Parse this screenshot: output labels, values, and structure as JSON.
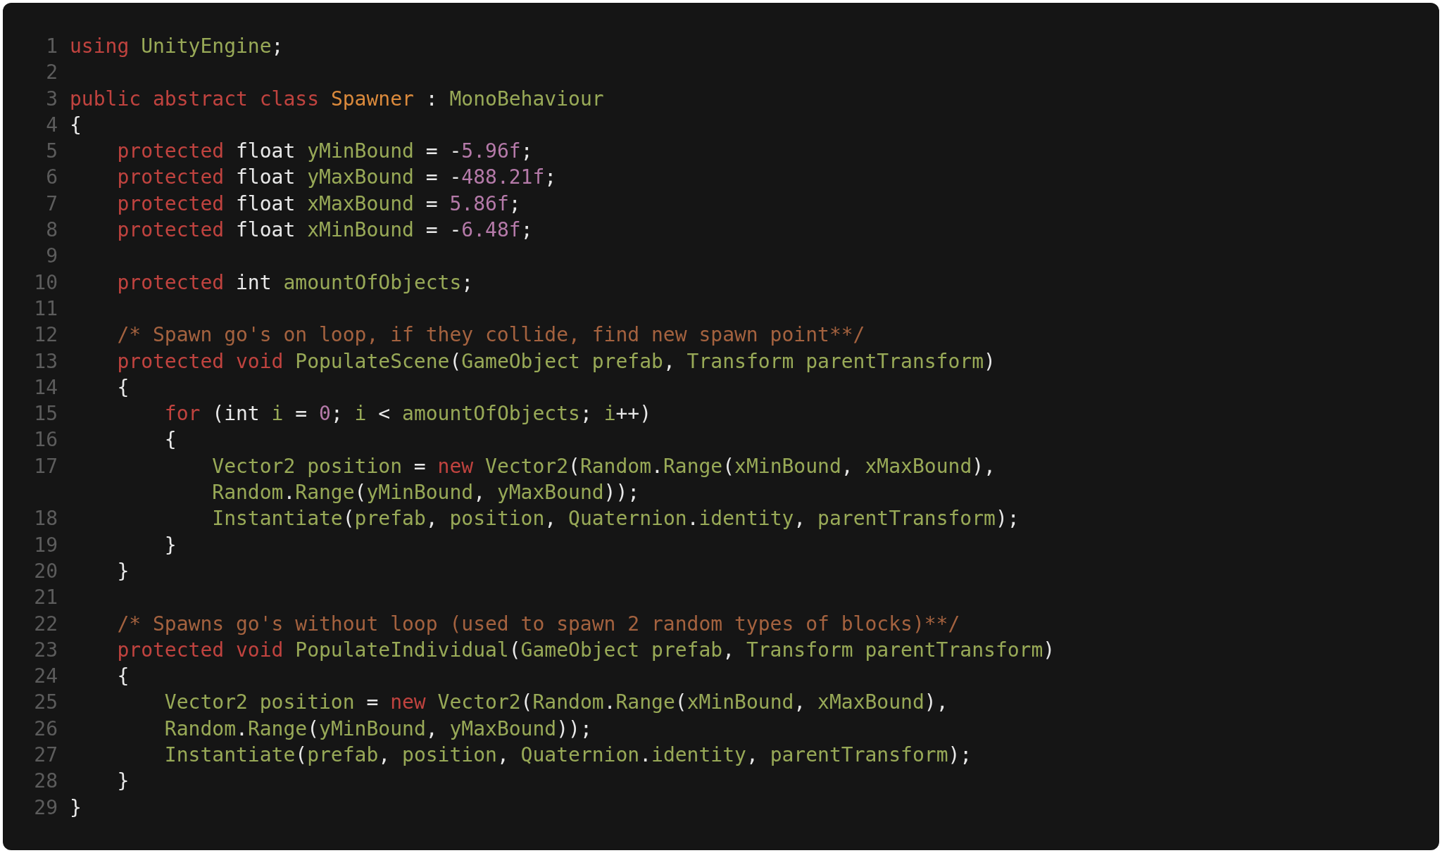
{
  "code_lines": [
    {
      "number": "1",
      "tokens": [
        {
          "text": "using ",
          "kind": "keyword"
        },
        {
          "text": "UnityEngine",
          "kind": "identifier"
        },
        {
          "text": ";",
          "kind": "plain"
        }
      ]
    },
    {
      "number": "2"
    },
    {
      "number": "3",
      "tokens": [
        {
          "text": "public abstract class ",
          "kind": "keyword"
        },
        {
          "text": "Spawner",
          "kind": "class"
        },
        {
          "text": " : ",
          "kind": "plain"
        },
        {
          "text": "MonoBehaviour",
          "kind": "identifier"
        }
      ]
    },
    {
      "number": "4",
      "tokens": [
        {
          "text": "{",
          "kind": "plain"
        }
      ]
    },
    {
      "number": "5",
      "tokens": [
        {
          "text": "    protected",
          "kind": "keyword"
        },
        {
          "text": " float ",
          "kind": "plain"
        },
        {
          "text": "yMinBound",
          "kind": "identifier"
        },
        {
          "text": " = -",
          "kind": "plain"
        },
        {
          "text": "5.96f",
          "kind": "number"
        },
        {
          "text": ";",
          "kind": "plain"
        }
      ]
    },
    {
      "number": "6",
      "tokens": [
        {
          "text": "    protected",
          "kind": "keyword"
        },
        {
          "text": " float ",
          "kind": "plain"
        },
        {
          "text": "yMaxBound",
          "kind": "identifier"
        },
        {
          "text": " = -",
          "kind": "plain"
        },
        {
          "text": "488.21f",
          "kind": "number"
        },
        {
          "text": ";",
          "kind": "plain"
        }
      ]
    },
    {
      "number": "7",
      "tokens": [
        {
          "text": "    protected",
          "kind": "keyword"
        },
        {
          "text": " float ",
          "kind": "plain"
        },
        {
          "text": "xMaxBound",
          "kind": "identifier"
        },
        {
          "text": " = ",
          "kind": "plain"
        },
        {
          "text": "5.86f",
          "kind": "number"
        },
        {
          "text": ";",
          "kind": "plain"
        }
      ]
    },
    {
      "number": "8",
      "tokens": [
        {
          "text": "    protected",
          "kind": "keyword"
        },
        {
          "text": " float ",
          "kind": "plain"
        },
        {
          "text": "xMinBound",
          "kind": "identifier"
        },
        {
          "text": " = -",
          "kind": "plain"
        },
        {
          "text": "6.48f",
          "kind": "number"
        },
        {
          "text": ";",
          "kind": "plain"
        }
      ]
    },
    {
      "number": "9"
    },
    {
      "number": "10",
      "tokens": [
        {
          "text": "    protected",
          "kind": "keyword"
        },
        {
          "text": " int ",
          "kind": "plain"
        },
        {
          "text": "amountOfObjects",
          "kind": "identifier"
        },
        {
          "text": ";",
          "kind": "plain"
        }
      ]
    },
    {
      "number": "11"
    },
    {
      "number": "12",
      "tokens": [
        {
          "text": "    /* Spawn go's on loop, if they collide, find new spawn point**/",
          "kind": "comment"
        }
      ]
    },
    {
      "number": "13",
      "tokens": [
        {
          "text": "    protected void ",
          "kind": "keyword"
        },
        {
          "text": "PopulateScene",
          "kind": "identifier"
        },
        {
          "text": "(",
          "kind": "plain"
        },
        {
          "text": "GameObject prefab",
          "kind": "identifier"
        },
        {
          "text": ", ",
          "kind": "plain"
        },
        {
          "text": "Transform parentTransform",
          "kind": "identifier"
        },
        {
          "text": ")",
          "kind": "plain"
        }
      ]
    },
    {
      "number": "14",
      "tokens": [
        {
          "text": "    {",
          "kind": "plain"
        }
      ]
    },
    {
      "number": "15",
      "tokens": [
        {
          "text": "        for",
          "kind": "keyword"
        },
        {
          "text": " (int ",
          "kind": "plain"
        },
        {
          "text": "i",
          "kind": "identifier"
        },
        {
          "text": " = ",
          "kind": "plain"
        },
        {
          "text": "0",
          "kind": "number"
        },
        {
          "text": "; ",
          "kind": "plain"
        },
        {
          "text": "i",
          "kind": "identifier"
        },
        {
          "text": " < ",
          "kind": "plain"
        },
        {
          "text": "amountOfObjects",
          "kind": "identifier"
        },
        {
          "text": "; ",
          "kind": "plain"
        },
        {
          "text": "i",
          "kind": "identifier"
        },
        {
          "text": "++)",
          "kind": "plain"
        }
      ]
    },
    {
      "number": "16",
      "tokens": [
        {
          "text": "        {",
          "kind": "plain"
        }
      ]
    },
    {
      "number": "17",
      "tokens": [
        {
          "text": "            Vector2 position",
          "kind": "identifier"
        },
        {
          "text": " = ",
          "kind": "plain"
        },
        {
          "text": "new ",
          "kind": "keyword"
        },
        {
          "text": "Vector2",
          "kind": "identifier"
        },
        {
          "text": "(",
          "kind": "plain"
        },
        {
          "text": "Random",
          "kind": "identifier"
        },
        {
          "text": ".",
          "kind": "plain"
        },
        {
          "text": "Range",
          "kind": "identifier"
        },
        {
          "text": "(",
          "kind": "plain"
        },
        {
          "text": "xMinBound",
          "kind": "identifier"
        },
        {
          "text": ", ",
          "kind": "plain"
        },
        {
          "text": "xMaxBound",
          "kind": "identifier"
        },
        {
          "text": "),",
          "kind": "plain"
        }
      ],
      "continuation": [
        {
          "text": "            Random",
          "kind": "identifier"
        },
        {
          "text": ".",
          "kind": "plain"
        },
        {
          "text": "Range",
          "kind": "identifier"
        },
        {
          "text": "(",
          "kind": "plain"
        },
        {
          "text": "yMinBound",
          "kind": "identifier"
        },
        {
          "text": ", ",
          "kind": "plain"
        },
        {
          "text": "yMaxBound",
          "kind": "identifier"
        },
        {
          "text": "));",
          "kind": "plain"
        }
      ]
    },
    {
      "number": "18",
      "tokens": [
        {
          "text": "            Instantiate",
          "kind": "identifier"
        },
        {
          "text": "(",
          "kind": "plain"
        },
        {
          "text": "prefab",
          "kind": "identifier"
        },
        {
          "text": ", ",
          "kind": "plain"
        },
        {
          "text": "position",
          "kind": "identifier"
        },
        {
          "text": ", ",
          "kind": "plain"
        },
        {
          "text": "Quaternion",
          "kind": "identifier"
        },
        {
          "text": ".",
          "kind": "plain"
        },
        {
          "text": "identity",
          "kind": "identifier"
        },
        {
          "text": ", ",
          "kind": "plain"
        },
        {
          "text": "parentTransform",
          "kind": "identifier"
        },
        {
          "text": ");",
          "kind": "plain"
        }
      ]
    },
    {
      "number": "19",
      "tokens": [
        {
          "text": "        }",
          "kind": "plain"
        }
      ]
    },
    {
      "number": "20",
      "tokens": [
        {
          "text": "    }",
          "kind": "plain"
        }
      ]
    },
    {
      "number": "21"
    },
    {
      "number": "22",
      "tokens": [
        {
          "text": "    /* Spawns go's without loop (used to spawn 2 random types of blocks)**/",
          "kind": "comment"
        }
      ]
    },
    {
      "number": "23",
      "tokens": [
        {
          "text": "    protected void ",
          "kind": "keyword"
        },
        {
          "text": "PopulateIndividual",
          "kind": "identifier"
        },
        {
          "text": "(",
          "kind": "plain"
        },
        {
          "text": "GameObject prefab",
          "kind": "identifier"
        },
        {
          "text": ", ",
          "kind": "plain"
        },
        {
          "text": "Transform parentTransform",
          "kind": "identifier"
        },
        {
          "text": ")",
          "kind": "plain"
        }
      ]
    },
    {
      "number": "24",
      "tokens": [
        {
          "text": "    {",
          "kind": "plain"
        }
      ]
    },
    {
      "number": "25",
      "tokens": [
        {
          "text": "        Vector2 position",
          "kind": "identifier"
        },
        {
          "text": " = ",
          "kind": "plain"
        },
        {
          "text": "new ",
          "kind": "keyword"
        },
        {
          "text": "Vector2",
          "kind": "identifier"
        },
        {
          "text": "(",
          "kind": "plain"
        },
        {
          "text": "Random",
          "kind": "identifier"
        },
        {
          "text": ".",
          "kind": "plain"
        },
        {
          "text": "Range",
          "kind": "identifier"
        },
        {
          "text": "(",
          "kind": "plain"
        },
        {
          "text": "xMinBound",
          "kind": "identifier"
        },
        {
          "text": ", ",
          "kind": "plain"
        },
        {
          "text": "xMaxBound",
          "kind": "identifier"
        },
        {
          "text": "),",
          "kind": "plain"
        }
      ]
    },
    {
      "number": "26",
      "tokens": [
        {
          "text": "        Random",
          "kind": "identifier"
        },
        {
          "text": ".",
          "kind": "plain"
        },
        {
          "text": "Range",
          "kind": "identifier"
        },
        {
          "text": "(",
          "kind": "plain"
        },
        {
          "text": "yMinBound",
          "kind": "identifier"
        },
        {
          "text": ", ",
          "kind": "plain"
        },
        {
          "text": "yMaxBound",
          "kind": "identifier"
        },
        {
          "text": "));",
          "kind": "plain"
        }
      ]
    },
    {
      "number": "27",
      "tokens": [
        {
          "text": "        Instantiate",
          "kind": "identifier"
        },
        {
          "text": "(",
          "kind": "plain"
        },
        {
          "text": "prefab",
          "kind": "identifier"
        },
        {
          "text": ", ",
          "kind": "plain"
        },
        {
          "text": "position",
          "kind": "identifier"
        },
        {
          "text": ", ",
          "kind": "plain"
        },
        {
          "text": "Quaternion",
          "kind": "identifier"
        },
        {
          "text": ".",
          "kind": "plain"
        },
        {
          "text": "identity",
          "kind": "identifier"
        },
        {
          "text": ", ",
          "kind": "plain"
        },
        {
          "text": "parentTransform",
          "kind": "identifier"
        },
        {
          "text": ");",
          "kind": "plain"
        }
      ]
    },
    {
      "number": "28",
      "tokens": [
        {
          "text": "    }",
          "kind": "plain"
        }
      ]
    },
    {
      "number": "29",
      "tokens": [
        {
          "text": "}",
          "kind": "plain"
        }
      ]
    }
  ]
}
